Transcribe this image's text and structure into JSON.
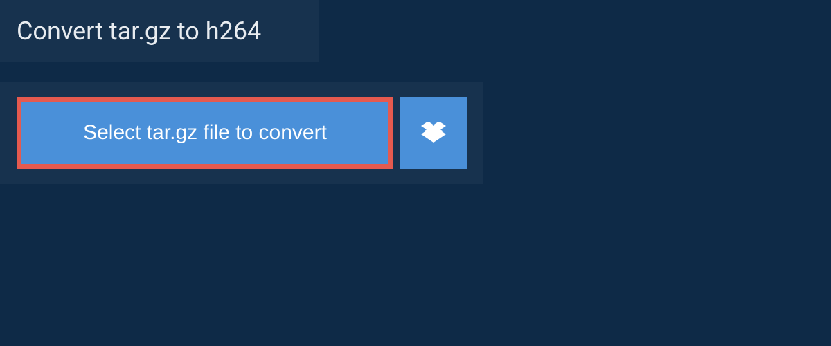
{
  "header": {
    "title": "Convert tar.gz to h264"
  },
  "upload": {
    "select_label": "Select tar.gz file to convert",
    "dropbox_icon": "dropbox-icon"
  },
  "colors": {
    "background": "#0e2a47",
    "panel": "#17324e",
    "button_bg": "#4a90d9",
    "button_border": "#e55a4f",
    "text_light": "#e8ecf0",
    "text_white": "#ffffff"
  }
}
